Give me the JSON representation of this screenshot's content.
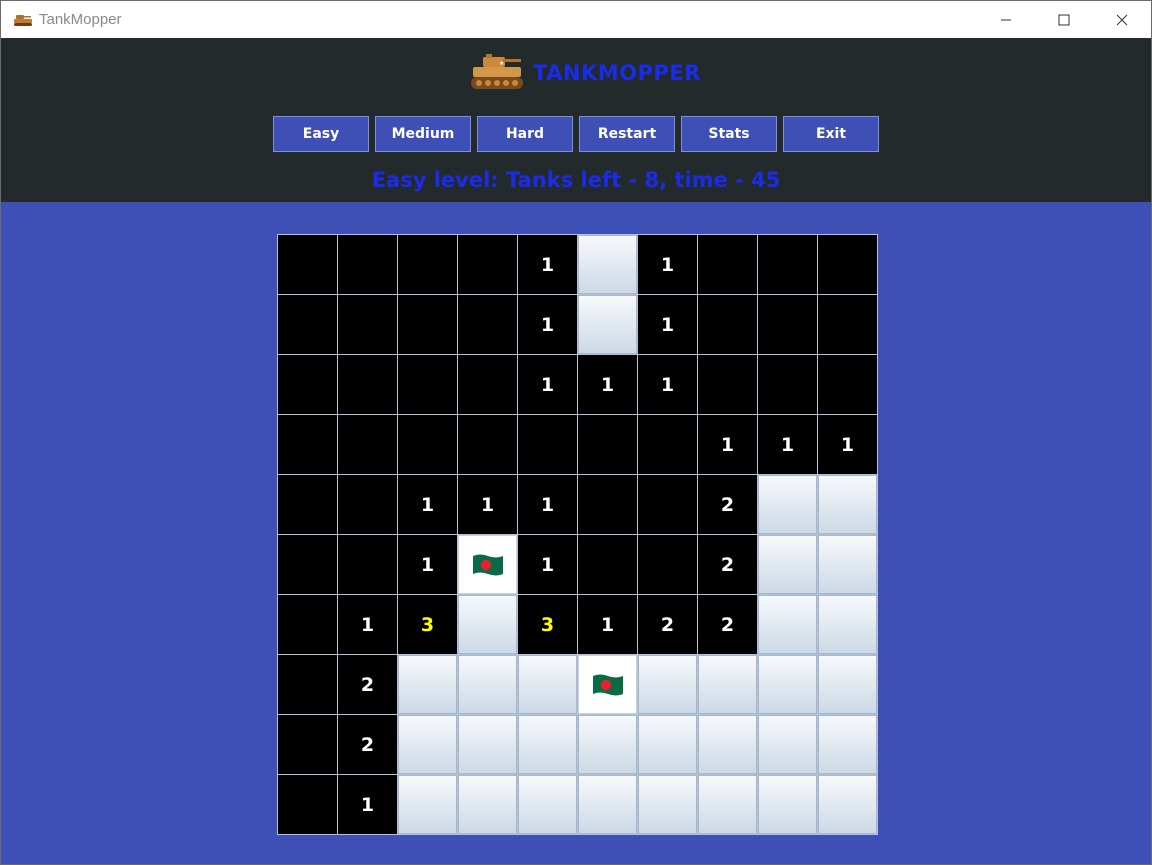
{
  "window": {
    "title": "TankMopper"
  },
  "header": {
    "brand": "TANKMOPPER"
  },
  "toolbar": [
    {
      "id": "easy",
      "label": "Easy"
    },
    {
      "id": "medium",
      "label": "Medium"
    },
    {
      "id": "hard",
      "label": "Hard"
    },
    {
      "id": "restart",
      "label": "Restart"
    },
    {
      "id": "stats",
      "label": "Stats"
    },
    {
      "id": "exit",
      "label": "Exit"
    }
  ],
  "status": {
    "text": "Easy level: Tanks left - 8, time - 45"
  },
  "colors": {
    "header_bg": "#232a2b",
    "body_bg": "#3e4fb6",
    "accent_text": "#1a2ce8",
    "number_3": "#ffff00"
  },
  "board": {
    "legend": {
      "R": "revealed-empty",
      "H": "hidden",
      "F": "flagged",
      "digit": "revealed-number"
    },
    "rows": [
      [
        "R",
        "R",
        "R",
        "R",
        "1",
        "H",
        "1",
        "R",
        "R",
        "R"
      ],
      [
        "R",
        "R",
        "R",
        "R",
        "1",
        "H",
        "1",
        "R",
        "R",
        "R"
      ],
      [
        "R",
        "R",
        "R",
        "R",
        "1",
        "1",
        "1",
        "R",
        "R",
        "R"
      ],
      [
        "R",
        "R",
        "R",
        "R",
        "R",
        "R",
        "R",
        "1",
        "1",
        "1"
      ],
      [
        "R",
        "R",
        "1",
        "1",
        "1",
        "R",
        "R",
        "2",
        "H",
        "H"
      ],
      [
        "R",
        "R",
        "1",
        "F",
        "1",
        "R",
        "R",
        "2",
        "H",
        "H"
      ],
      [
        "R",
        "1",
        "3",
        "H",
        "3",
        "1",
        "2",
        "2",
        "H",
        "H"
      ],
      [
        "R",
        "2",
        "H",
        "H",
        "H",
        "F",
        "H",
        "H",
        "H",
        "H"
      ],
      [
        "R",
        "2",
        "H",
        "H",
        "H",
        "H",
        "H",
        "H",
        "H",
        "H"
      ],
      [
        "R",
        "1",
        "H",
        "H",
        "H",
        "H",
        "H",
        "H",
        "H",
        "H"
      ]
    ]
  }
}
